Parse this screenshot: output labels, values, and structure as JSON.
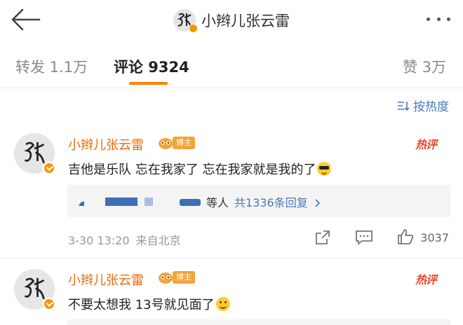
{
  "header": {
    "title": "小辫儿张云雷",
    "back_icon": "back-arrow-icon",
    "more_icon": "more-dots-icon"
  },
  "tabs": [
    {
      "label": "转发 1.1万",
      "active": false
    },
    {
      "label": "评论 9324",
      "active": true
    },
    {
      "label": "赞 3万",
      "active": false
    }
  ],
  "sort": {
    "label": "按热度"
  },
  "colors": {
    "accent": "#ff8200",
    "name": "#e86b0c",
    "link": "#4a7ab8",
    "hot": "#e84a2a",
    "verified": "#f39800"
  },
  "comments": [
    {
      "author": "小辫儿张云雷",
      "owner_tag": "博主",
      "hot_label": "热评",
      "text": "吉他是乐队 忘在我家了 忘在我家就是我的了",
      "emoji": "cool-sunglasses-emoji",
      "replies": {
        "suffix": "等人",
        "link": "共1336条回复"
      },
      "time": "3-30 13:20",
      "source": "来自北京",
      "likes": "3037"
    },
    {
      "author": "小辫儿张云雷",
      "owner_tag": "博主",
      "hot_label": "热评",
      "text": "不要太想我 13号就见面了",
      "emoji": "smile-emoji"
    }
  ]
}
